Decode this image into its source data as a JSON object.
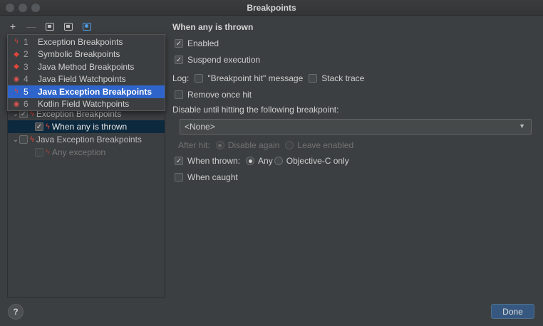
{
  "window": {
    "title": "Breakpoints"
  },
  "toolbar": {
    "add_icon": "plus-icon",
    "remove_icon": "minus-icon",
    "group_icons": [
      "group-by-package-icon",
      "group-by-class-icon",
      "group-by-file-icon"
    ]
  },
  "popup": {
    "items": [
      {
        "num": "1",
        "label": "Exception Breakpoints",
        "icon": "bolt-icon"
      },
      {
        "num": "2",
        "label": "Symbolic Breakpoints",
        "icon": "diamond-icon"
      },
      {
        "num": "3",
        "label": "Java Method Breakpoints",
        "icon": "diamond-icon"
      },
      {
        "num": "4",
        "label": "Java Field Watchpoints",
        "icon": "eye-icon"
      },
      {
        "num": "5",
        "label": "Java Exception Breakpoints",
        "icon": "bolt-icon",
        "selected": true
      },
      {
        "num": "6",
        "label": "Kotlin Field Watchpoints",
        "icon": "eye-icon"
      }
    ]
  },
  "tree": {
    "group1_label": "Exception Breakpoints",
    "group1_child": "When any is thrown",
    "group2_label": "Java Exception Breakpoints",
    "group2_child": "Any exception"
  },
  "detail": {
    "heading": "When any is thrown",
    "enabled_label": "Enabled",
    "suspend_label": "Suspend execution",
    "log_label": "Log:",
    "log_message_label": "\"Breakpoint hit\" message",
    "stack_trace_label": "Stack trace",
    "remove_once_label": "Remove once hit",
    "disable_until_label": "Disable until hitting the following breakpoint:",
    "dropdown_value": "<None>",
    "after_hit_label": "After hit:",
    "disable_again_label": "Disable again",
    "leave_enabled_label": "Leave enabled",
    "when_thrown_label": "When thrown:",
    "any_label": "Any",
    "objc_only_label": "Objective-C only",
    "when_caught_label": "When caught"
  },
  "footer": {
    "help": "?",
    "done": "Done"
  },
  "colors": {
    "selection": "#2f65ca",
    "done_button": "#365880",
    "breakpoint_red": "#e0453b"
  }
}
